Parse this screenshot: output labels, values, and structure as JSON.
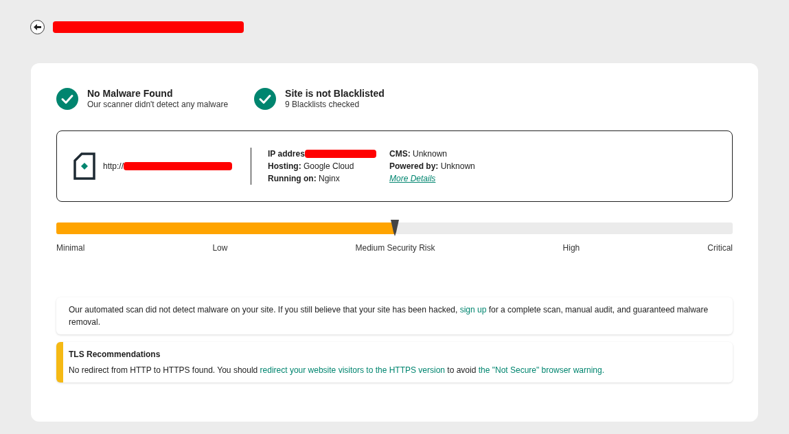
{
  "header": {
    "redacted": true
  },
  "checks": [
    {
      "title": "No Malware Found",
      "subtitle": "Our scanner didn't detect any malware",
      "passed": true
    },
    {
      "title": "Site is not Blacklisted",
      "subtitle": "9 Blacklists checked",
      "passed": true
    }
  ],
  "site": {
    "url": "http://",
    "url_redacted": true,
    "details": [
      {
        "label": "IP addres",
        "redacted": true
      },
      {
        "label": "Hosting:",
        "value": "Google Cloud",
        "redacted": false
      },
      {
        "label": "Running on:",
        "value": "Nginx",
        "redacted": false
      }
    ],
    "details_2": [
      {
        "label": "CMS:",
        "value": "Unknown"
      },
      {
        "label": "Powered by:",
        "value": "Unknown"
      }
    ],
    "more_link": "More Details"
  },
  "risk": {
    "level": 0.5,
    "labels": [
      "Minimal",
      "Low",
      "Medium Security Risk",
      "High",
      "Critical"
    ]
  },
  "notices": [
    {
      "kind": "plain",
      "parts": [
        {
          "kind": "text",
          "text": "Our automated scan did not detect malware on your site. If you still believe that your site has been hacked, "
        },
        {
          "kind": "link",
          "text": "sign up"
        },
        {
          "kind": "text",
          "text": " for a complete scan, manual audit, and guaranteed malware removal."
        }
      ]
    },
    {
      "kind": "warning",
      "title": "TLS Recommendations",
      "parts": [
        {
          "kind": "text",
          "text": "No redirect from HTTP to HTTPS found. You should "
        },
        {
          "kind": "link",
          "text": "redirect your website visitors to the HTTPS version"
        },
        {
          "kind": "text",
          "text": " to avoid "
        },
        {
          "kind": "link",
          "text": "the \"Not Secure\" browser warning."
        }
      ]
    }
  ]
}
